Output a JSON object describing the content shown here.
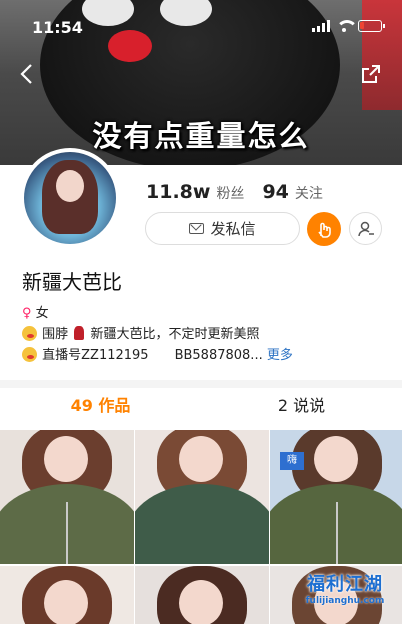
{
  "status_bar": {
    "time": "11:54"
  },
  "banner": {
    "caption": "没有点重量怎么"
  },
  "profile": {
    "followers_count": "11.8w",
    "followers_label": "粉丝",
    "following_count": "94",
    "following_label": "关注",
    "message_button": "发私信",
    "name": "新疆大芭比",
    "gender": "女",
    "bio_line1_pre": "围脖",
    "bio_line1_post": "新疆大芭比，不定时更新美照",
    "bio_line2": "直播号ZZ112195　　BB5887808...",
    "more_label": "更多"
  },
  "tabs": [
    {
      "label": "49 作品",
      "active": true
    },
    {
      "label": "2 说说",
      "active": false
    }
  ],
  "grid_badge": "嗨",
  "watermark": {
    "title": "福利江湖",
    "url": "fulijianghu.com"
  },
  "colors": {
    "accent": "#ff8200",
    "link": "#2b72c3"
  }
}
